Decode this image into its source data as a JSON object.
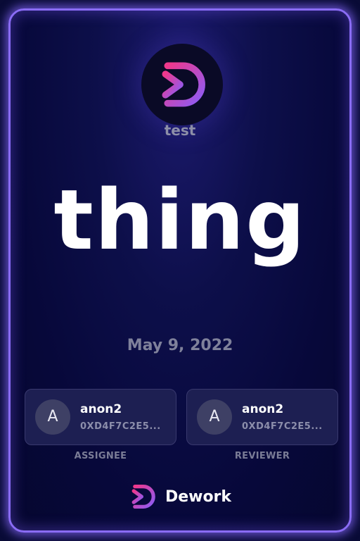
{
  "space": {
    "name": "test",
    "logo_icon": "dework-logo-icon"
  },
  "task": {
    "title": "thing",
    "date": "May 9, 2022"
  },
  "assignee": {
    "avatar_letter": "A",
    "name": "anon2",
    "address": "0XD4F7C2E5...",
    "role_label": "ASSIGNEE"
  },
  "reviewer": {
    "avatar_letter": "A",
    "name": "anon2",
    "address": "0XD4F7C2E5...",
    "role_label": "REVIEWER"
  },
  "footer": {
    "brand": "Dework",
    "logo_icon": "dework-logo-icon"
  },
  "colors": {
    "background": "#06072f",
    "border_glow": "#8a6cf5",
    "logo_gradient_start": "#f0388c",
    "logo_gradient_end": "#8b5cf6"
  }
}
